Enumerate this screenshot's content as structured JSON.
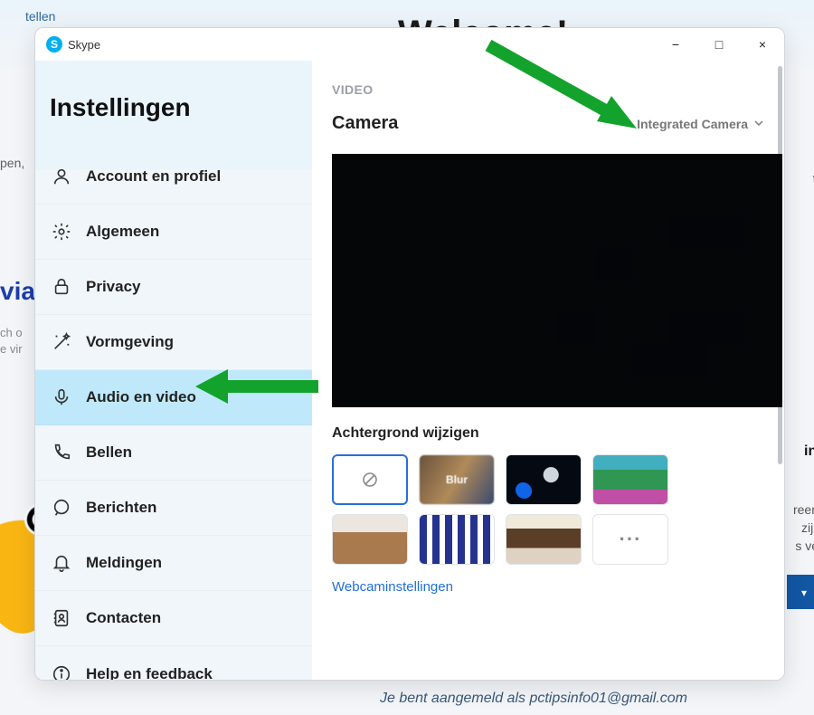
{
  "app_name": "Skype",
  "background": {
    "tellen": "tellen",
    "welcome": "Welcome!",
    "open": "pen,",
    "via": "via",
    "cho": "ch o",
    "evi": "e vir",
    "te": "te",
    "ing": "ing",
    "reen": "reen",
    "zijn": "zijn",
    "sve": "s ve",
    "signed_prefix": "Je bent aangemeld als ",
    "signed_email": "pctipsinfo01@gmail.com"
  },
  "sidebar": {
    "title": "Instellingen",
    "items": [
      {
        "id": "account",
        "label": "Account en profiel",
        "icon": "user"
      },
      {
        "id": "general",
        "label": "Algemeen",
        "icon": "gear"
      },
      {
        "id": "privacy",
        "label": "Privacy",
        "icon": "lock"
      },
      {
        "id": "appearance",
        "label": "Vormgeving",
        "icon": "wand"
      },
      {
        "id": "audio-video",
        "label": "Audio en video",
        "icon": "mic",
        "selected": true
      },
      {
        "id": "calling",
        "label": "Bellen",
        "icon": "phone"
      },
      {
        "id": "messaging",
        "label": "Berichten",
        "icon": "chat"
      },
      {
        "id": "notifications",
        "label": "Meldingen",
        "icon": "bell"
      },
      {
        "id": "contacts",
        "label": "Contacten",
        "icon": "contacts"
      },
      {
        "id": "help",
        "label": "Help en feedback",
        "icon": "info"
      }
    ]
  },
  "video": {
    "section_label": "VIDEO",
    "camera_label": "Camera",
    "selected_camera": "Integrated Camera",
    "bg_change_title": "Achtergrond wijzigen",
    "tiles": {
      "blur": "Blur",
      "more": "···"
    },
    "webcam_link": "Webcaminstellingen"
  },
  "window": {
    "minimize": "−",
    "maximize": "□",
    "close": "×"
  }
}
